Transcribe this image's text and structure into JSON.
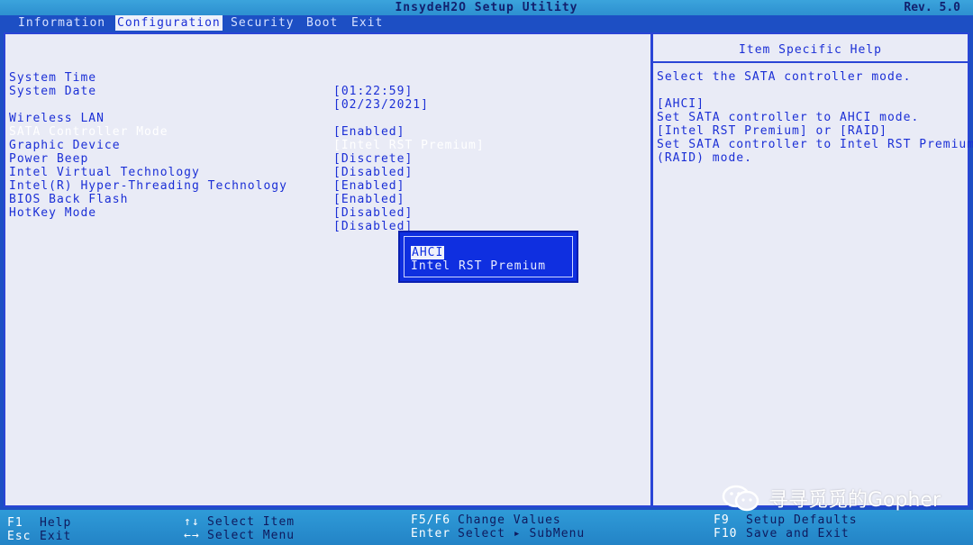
{
  "window": {
    "title": "InsydeH2O Setup Utility",
    "revision": "Rev. 5.0"
  },
  "menu": {
    "tabs": [
      {
        "label": "Information"
      },
      {
        "label": "Configuration"
      },
      {
        "label": "Security"
      },
      {
        "label": "Boot"
      },
      {
        "label": "Exit"
      }
    ]
  },
  "settings": [
    {
      "label": "System Time",
      "value": "[01:22:59]"
    },
    {
      "label": "System Date",
      "value": "[02/23/2021]"
    },
    {
      "label": "Wireless LAN",
      "value": "[Enabled]"
    },
    {
      "label": "SATA Controller Mode",
      "value": "[Intel RST Premium]"
    },
    {
      "label": "Graphic Device",
      "value": "[Discrete]"
    },
    {
      "label": "Power Beep",
      "value": "[Disabled]"
    },
    {
      "label": "Intel Virtual Technology",
      "value": "[Enabled]"
    },
    {
      "label": "Intel(R) Hyper-Threading Technology",
      "value": "[Enabled]"
    },
    {
      "label": "BIOS Back Flash",
      "value": "[Disabled]"
    },
    {
      "label": "HotKey Mode",
      "value": "[Disabled]"
    }
  ],
  "help": {
    "title": "Item Specific Help",
    "lines": [
      "Select the SATA controller mode.",
      "",
      "[AHCI]",
      "Set SATA controller to AHCI mode.",
      "[Intel RST Premium] or [RAID]",
      "Set SATA controller to Intel RST Premium",
      "(RAID) mode."
    ]
  },
  "popup": {
    "options": [
      "AHCI",
      "Intel RST Premium"
    ]
  },
  "footer": {
    "f1_key": "F1",
    "f1_label": "Help",
    "esc_key": "Esc",
    "esc_label": "Exit",
    "updown_key": "↑↓",
    "updown_label": "Select Item",
    "leftright_key": "←→",
    "leftright_label": "Select Menu",
    "f5f6_key": "F5/F6",
    "f5f6_label": "Change Values",
    "enter_key": "Enter",
    "enter_label": "Select ▸ SubMenu",
    "f9_key": "F9",
    "f9_label": "Setup Defaults",
    "f10_key": "F10",
    "f10_label": "Save and Exit"
  },
  "watermark": {
    "text": "寻寻觅觅的Gopher"
  }
}
